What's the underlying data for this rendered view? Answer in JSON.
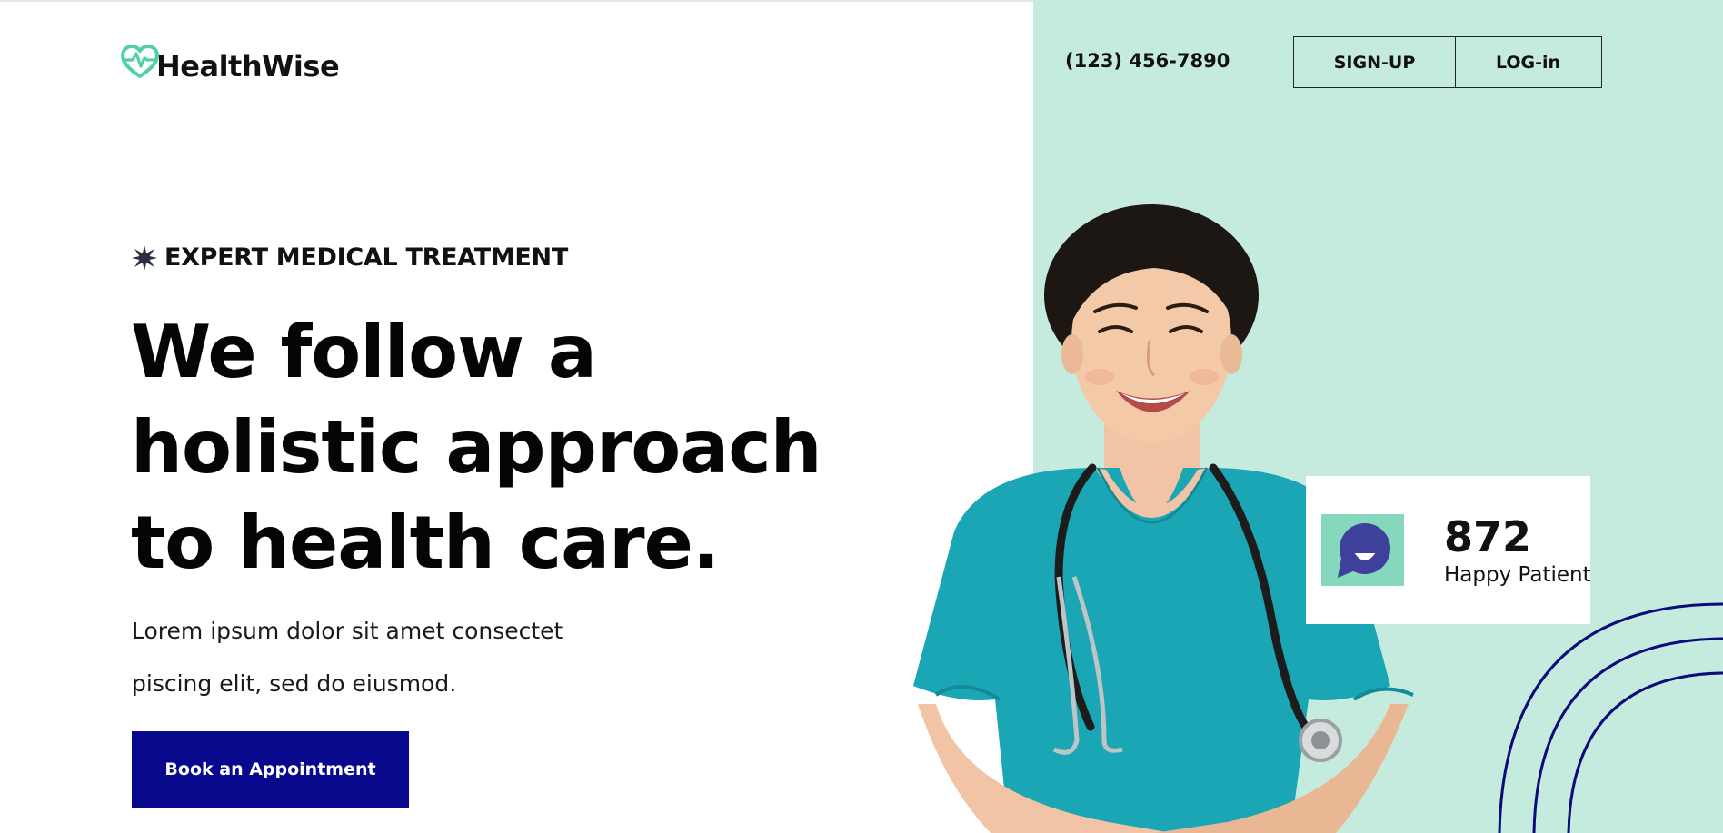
{
  "brand": {
    "name": "HealthWise",
    "accent": "#4fd1a5",
    "logo_icon": "heart-pulse-icon"
  },
  "header": {
    "phone": "(123) 456-7890",
    "signup_label": "SIGN-UP",
    "login_label": "LOG-in"
  },
  "hero": {
    "eyebrow": "EXPERT MEDICAL TREATMENT",
    "eyebrow_icon": "star-burst-icon",
    "headline": [
      "We follow a",
      "holistic approach",
      "to health care."
    ],
    "description": [
      "Lorem ipsum dolor sit amet consectet",
      "piscing elit, sed do eiusmod."
    ],
    "cta_label": "Book an Appointment"
  },
  "stats": {
    "value": "872",
    "label": "Happy Patients",
    "icon": "chat-bubble-icon"
  },
  "colors": {
    "panel": "#c4ebdd",
    "cta": "#08088c",
    "arcs": "#0b0b7a",
    "scrubs": "#1aa6b4",
    "stat_icon_bg": "#86d8bd"
  }
}
